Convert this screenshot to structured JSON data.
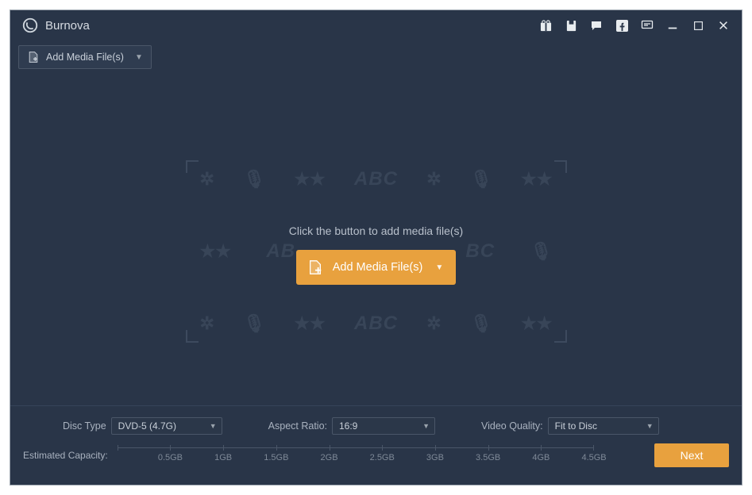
{
  "app": {
    "title": "Burnova"
  },
  "titlebar_icons": [
    "gift-icon",
    "save-icon",
    "chat-icon",
    "facebook-icon",
    "feedback-icon",
    "minimize-icon",
    "maximize-icon",
    "close-icon"
  ],
  "toolbar": {
    "add_top_label": "Add Media File(s)"
  },
  "center": {
    "hint": "Click the button to add media file(s)",
    "add_center_label": "Add Media File(s)"
  },
  "bottom": {
    "disc_type_label": "Disc Type",
    "disc_type_value": "DVD-5 (4.7G)",
    "aspect_label": "Aspect Ratio:",
    "aspect_value": "16:9",
    "quality_label": "Video Quality:",
    "quality_value": "Fit to Disc",
    "capacity_label": "Estimated Capacity:",
    "ticks": [
      "0.5GB",
      "1GB",
      "1.5GB",
      "2GB",
      "2.5GB",
      "3GB",
      "3.5GB",
      "4GB",
      "4.5GB"
    ],
    "next_label": "Next"
  },
  "colors": {
    "accent": "#e8a13e",
    "bg": "#293548"
  }
}
